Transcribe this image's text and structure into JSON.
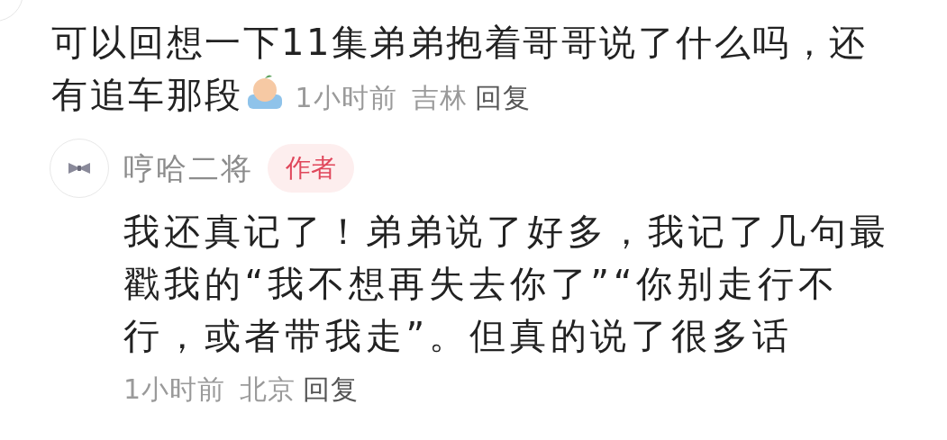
{
  "comment": {
    "text_lines": [
      "可以回想一下11集弟弟抱着哥哥说了什么吗，还",
      "有追车那段"
    ],
    "time": "1小时前",
    "location": "吉林",
    "reply": "回复"
  },
  "replies": [
    {
      "author": "哼哈二将",
      "badge": "作者",
      "text": "我还真记了！弟弟说了好多，我记了几句最戳我的“我不想再失去你了”“你别走行不行，或者带我走”。但真的说了很多话",
      "time": "1小时前",
      "location": "北京",
      "reply": "回复"
    }
  ]
}
